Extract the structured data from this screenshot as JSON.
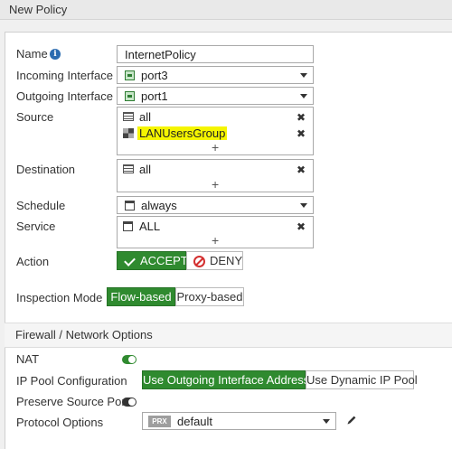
{
  "header": {
    "title": "New Policy"
  },
  "form": {
    "name": {
      "label": "Name",
      "value": "InternetPolicy",
      "info_icon": "info-icon"
    },
    "incoming": {
      "label": "Incoming Interface",
      "value": "port3"
    },
    "outgoing": {
      "label": "Outgoing Interface",
      "value": "port1"
    },
    "source": {
      "label": "Source",
      "items": [
        "all",
        "LANUsersGroup"
      ]
    },
    "destination": {
      "label": "Destination",
      "items": [
        "all"
      ]
    },
    "schedule": {
      "label": "Schedule",
      "value": "always"
    },
    "service": {
      "label": "Service",
      "items": [
        "ALL"
      ]
    },
    "action": {
      "label": "Action",
      "accept": "ACCEPT",
      "deny": "DENY",
      "selected": "ACCEPT"
    },
    "inspection": {
      "label": "Inspection Mode",
      "options": [
        "Flow-based",
        "Proxy-based"
      ],
      "selected": "Flow-based"
    }
  },
  "firewall": {
    "section_title": "Firewall / Network Options",
    "nat": {
      "label": "NAT",
      "enabled": true
    },
    "ip_pool": {
      "label": "IP Pool Configuration",
      "options": [
        "Use Outgoing Interface Address",
        "Use Dynamic IP Pool"
      ],
      "selected": "Use Outgoing Interface Address"
    },
    "preserve_port": {
      "label": "Preserve Source Port",
      "enabled": false
    },
    "protocol": {
      "label": "Protocol Options",
      "tag": "PRX",
      "value": "default"
    }
  },
  "colors": {
    "accent": "#2f8a2f",
    "highlight": "#f5f500",
    "deny": "#d32f2f"
  }
}
